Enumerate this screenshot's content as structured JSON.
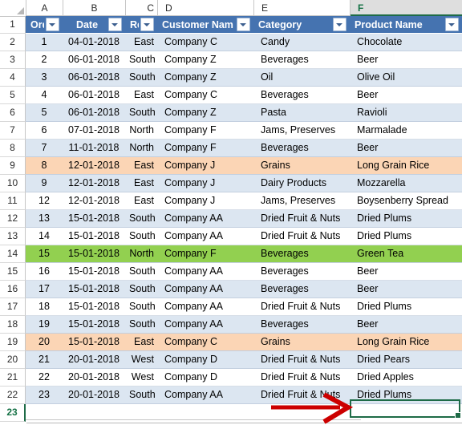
{
  "app": {
    "type": "spreadsheet",
    "name": "excel-worksheet"
  },
  "columns": {
    "letters": [
      "A",
      "B",
      "C",
      "D",
      "E",
      "F"
    ],
    "selected_letter": "F"
  },
  "table_header": {
    "row_number": "1",
    "cells": [
      {
        "label": "Order",
        "column": "A",
        "filter_icon": "filter-dropdown-icon"
      },
      {
        "label": "Date",
        "column": "B",
        "filter_icon": "filter-dropdown-icon"
      },
      {
        "label": "Regio",
        "column": "C",
        "filter_icon": "filter-dropdown-icon"
      },
      {
        "label": "Customer Nam",
        "column": "D",
        "filter_icon": "filter-dropdown-icon"
      },
      {
        "label": "Category",
        "column": "E",
        "filter_icon": "filter-dropdown-icon"
      },
      {
        "label": "Product Name",
        "column": "F",
        "filter_icon": "filter-dropdown-icon"
      }
    ]
  },
  "colors": {
    "header_fill": "#4573b0",
    "band_blue": "#dce6f1",
    "band_white": "#ffffff",
    "highlight_orange": "#fbd5b5",
    "highlight_green": "#92d050",
    "selection_green": "#1e6b47",
    "annotation_red": "#cc0000"
  },
  "selection": {
    "active_cell": "F23",
    "row_number": "23",
    "column_letter": "F"
  },
  "annotation": {
    "type": "arrow",
    "name": "red-arrow-annotation",
    "color": "#cc0000",
    "points_to": "F23"
  },
  "rows": [
    {
      "n": "2",
      "fill": "blue",
      "order": "1",
      "date": "04-01-2018",
      "region": "East",
      "customer": "Company C",
      "category": "Candy",
      "product": "Chocolate"
    },
    {
      "n": "3",
      "fill": "white",
      "order": "2",
      "date": "06-01-2018",
      "region": "South",
      "customer": "Company Z",
      "category": "Beverages",
      "product": "Beer"
    },
    {
      "n": "4",
      "fill": "blue",
      "order": "3",
      "date": "06-01-2018",
      "region": "South",
      "customer": "Company Z",
      "category": "Oil",
      "product": "Olive Oil"
    },
    {
      "n": "5",
      "fill": "white",
      "order": "4",
      "date": "06-01-2018",
      "region": "East",
      "customer": "Company C",
      "category": "Beverages",
      "product": "Beer"
    },
    {
      "n": "6",
      "fill": "blue",
      "order": "5",
      "date": "06-01-2018",
      "region": "South",
      "customer": "Company Z",
      "category": "Pasta",
      "product": "Ravioli"
    },
    {
      "n": "7",
      "fill": "white",
      "order": "6",
      "date": "07-01-2018",
      "region": "North",
      "customer": "Company F",
      "category": "Jams, Preserves",
      "product": "Marmalade"
    },
    {
      "n": "8",
      "fill": "blue",
      "order": "7",
      "date": "11-01-2018",
      "region": "North",
      "customer": "Company F",
      "category": "Beverages",
      "product": "Beer"
    },
    {
      "n": "9",
      "fill": "orange",
      "order": "8",
      "date": "12-01-2018",
      "region": "East",
      "customer": "Company J",
      "category": "Grains",
      "product": "Long Grain Rice"
    },
    {
      "n": "10",
      "fill": "blue",
      "order": "9",
      "date": "12-01-2018",
      "region": "East",
      "customer": "Company J",
      "category": "Dairy Products",
      "product": "Mozzarella"
    },
    {
      "n": "11",
      "fill": "white",
      "order": "12",
      "date": "12-01-2018",
      "region": "East",
      "customer": "Company J",
      "category": "Jams, Preserves",
      "product": "Boysenberry Spread"
    },
    {
      "n": "12",
      "fill": "blue",
      "order": "13",
      "date": "15-01-2018",
      "region": "South",
      "customer": "Company AA",
      "category": "Dried Fruit & Nuts",
      "product": "Dried Plums"
    },
    {
      "n": "13",
      "fill": "white",
      "order": "14",
      "date": "15-01-2018",
      "region": "South",
      "customer": "Company AA",
      "category": "Dried Fruit & Nuts",
      "product": "Dried Plums"
    },
    {
      "n": "14",
      "fill": "green",
      "order": "15",
      "date": "15-01-2018",
      "region": "North",
      "customer": "Company F",
      "category": "Beverages",
      "product": "Green Tea"
    },
    {
      "n": "15",
      "fill": "white",
      "order": "16",
      "date": "15-01-2018",
      "region": "South",
      "customer": "Company AA",
      "category": "Beverages",
      "product": "Beer"
    },
    {
      "n": "16",
      "fill": "blue",
      "order": "17",
      "date": "15-01-2018",
      "region": "South",
      "customer": "Company AA",
      "category": "Beverages",
      "product": "Beer"
    },
    {
      "n": "17",
      "fill": "white",
      "order": "18",
      "date": "15-01-2018",
      "region": "South",
      "customer": "Company AA",
      "category": "Dried Fruit & Nuts",
      "product": "Dried Plums"
    },
    {
      "n": "18",
      "fill": "blue",
      "order": "19",
      "date": "15-01-2018",
      "region": "South",
      "customer": "Company AA",
      "category": "Beverages",
      "product": "Beer"
    },
    {
      "n": "19",
      "fill": "orange",
      "order": "20",
      "date": "15-01-2018",
      "region": "East",
      "customer": "Company C",
      "category": "Grains",
      "product": "Long Grain Rice"
    },
    {
      "n": "20",
      "fill": "blue",
      "order": "21",
      "date": "20-01-2018",
      "region": "West",
      "customer": "Company D",
      "category": "Dried Fruit & Nuts",
      "product": "Dried Pears"
    },
    {
      "n": "21",
      "fill": "white",
      "order": "22",
      "date": "20-01-2018",
      "region": "West",
      "customer": "Company D",
      "category": "Dried Fruit & Nuts",
      "product": "Dried Apples"
    },
    {
      "n": "22",
      "fill": "blue",
      "order": "23",
      "date": "20-01-2018",
      "region": "South",
      "customer": "Company AA",
      "category": "Dried Fruit & Nuts",
      "product": "Dried Plums"
    },
    {
      "n": "23",
      "fill": "empty",
      "order": "",
      "date": "",
      "region": "",
      "customer": "",
      "category": "",
      "product": ""
    }
  ]
}
